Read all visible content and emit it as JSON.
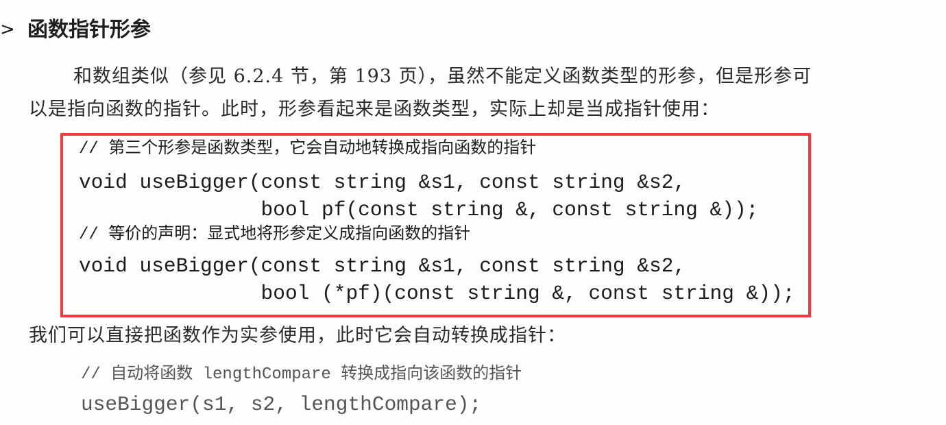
{
  "section": {
    "marker": ">",
    "title": "函数指针形参"
  },
  "paragraph1": {
    "line1": "和数组类似（参见 6.2.4 节，第 193 页），虽然不能定义函数类型的形参，但是形参可",
    "line2": "以是指向函数的指针。此时，形参看起来是函数类型，实际上却是当成指针使用："
  },
  "highlighted_code": {
    "comment1": "// 第三个形参是函数类型，它会自动地转换成指向函数的指针",
    "line1": "void useBigger(const string &s1, const string &s2,",
    "line2": "               bool pf(const string &, const string &));",
    "comment2": "// 等价的声明：显式地将形参定义成指向函数的指针",
    "line3": "void useBigger(const string &s1, const string &s2,",
    "line4": "               bool (*pf)(const string &, const string &));",
    "highlight_color": "#ee3b3f"
  },
  "paragraph2": "我们可以直接把函数作为实参使用，此时它会自动转换成指针：",
  "example_code": {
    "comment": "// 自动将函数 lengthCompare 转换成指向该函数的指针",
    "line": "useBigger(s1, s2, lengthCompare);"
  }
}
